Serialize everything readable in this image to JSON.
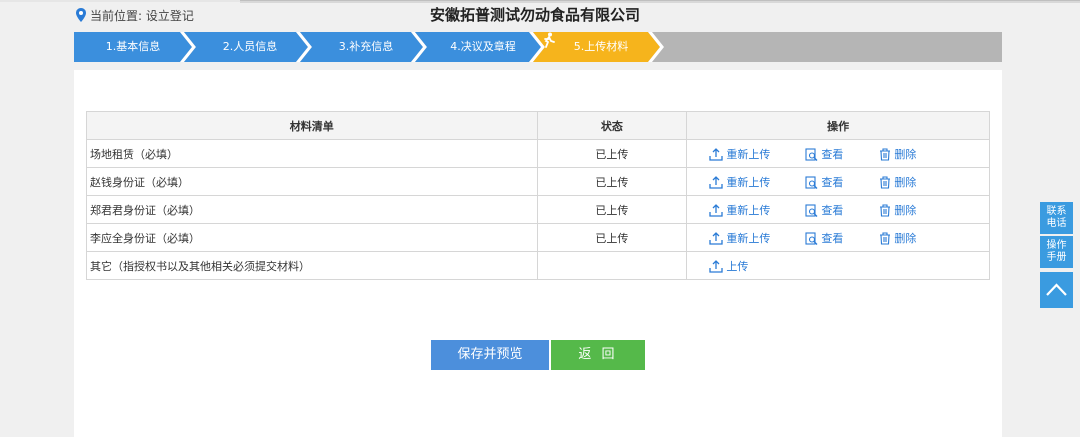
{
  "header": {
    "location_label": "当前位置: 设立登记",
    "company_name": "安徽拓普测试勿动食品有限公司"
  },
  "steps": [
    {
      "label": "1.基本信息",
      "state": "done"
    },
    {
      "label": "2.人员信息",
      "state": "done"
    },
    {
      "label": "3.补充信息",
      "state": "done"
    },
    {
      "label": "4.决议及章程",
      "state": "done"
    },
    {
      "label": "5.上传材料",
      "state": "current"
    }
  ],
  "colors": {
    "step_done": "#3b8fdd",
    "step_current": "#f6b41c",
    "step_rest": "#b5b5b5",
    "link": "#2a7bd6",
    "save_button": "#4c8fdc",
    "back_button": "#55b94a",
    "side_panel": "#3a9be0"
  },
  "table": {
    "headers": [
      "材料清单",
      "状态",
      "操作"
    ],
    "rows": [
      {
        "name": "场地租赁（必填）",
        "status": "已上传",
        "actions": [
          "重新上传",
          "查看",
          "删除"
        ]
      },
      {
        "name": "赵钱身份证（必填）",
        "status": "已上传",
        "actions": [
          "重新上传",
          "查看",
          "删除"
        ]
      },
      {
        "name": "郑君君身份证（必填）",
        "status": "已上传",
        "actions": [
          "重新上传",
          "查看",
          "删除"
        ]
      },
      {
        "name": "李应全身份证（必填）",
        "status": "已上传",
        "actions": [
          "重新上传",
          "查看",
          "删除"
        ]
      },
      {
        "name": "其它（指授权书以及其他相关必须提交材料）",
        "status": "",
        "actions": [
          "上传"
        ]
      }
    ]
  },
  "buttons": {
    "save_preview": "保存并预览",
    "back": "返 回"
  },
  "side_panel": {
    "contact_line1": "联系",
    "contact_line2": "电话",
    "manual_line1": "操作",
    "manual_line2": "手册",
    "top_icon": "chevron-up-icon"
  }
}
